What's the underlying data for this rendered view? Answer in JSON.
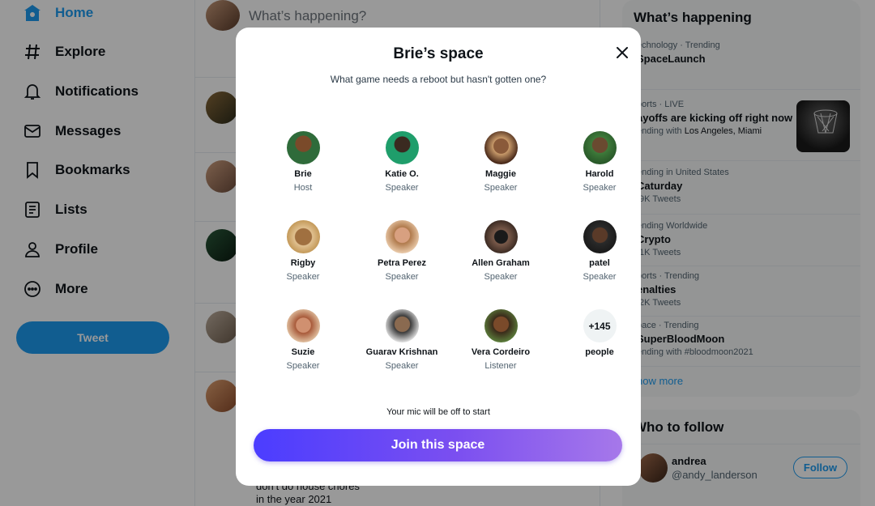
{
  "sidebar": {
    "items": [
      {
        "label": "Home",
        "icon": "home-icon"
      },
      {
        "label": "Explore",
        "icon": "hashtag-icon"
      },
      {
        "label": "Notifications",
        "icon": "bell-icon"
      },
      {
        "label": "Messages",
        "icon": "envelope-icon"
      },
      {
        "label": "Bookmarks",
        "icon": "bookmark-icon"
      },
      {
        "label": "Lists",
        "icon": "list-icon"
      },
      {
        "label": "Profile",
        "icon": "person-icon"
      },
      {
        "label": "More",
        "icon": "more-circle-icon"
      }
    ],
    "tweet_label": "Tweet"
  },
  "feed": {
    "compose_placeholder": "What’s happening?",
    "partial_tweet_line1": "don’t do house chores",
    "partial_tweet_line2": "in the year 2021"
  },
  "trends": {
    "title": "What’s happening",
    "items": [
      {
        "meta": "echnology · Trending",
        "name": "SpaceLaunch",
        "sub": ""
      },
      {
        "meta": "ports · LIVE",
        "name": "ayoffs are kicking off right now",
        "sub_prefix": "ending with ",
        "sub_bold": "Los Angeles, Miami"
      },
      {
        "meta": "ending in United States",
        "name": "Caturday",
        "sub": ".9K Tweets"
      },
      {
        "meta": "ending Worldwide",
        "name": "Crypto",
        "sub": ".1K Tweets"
      },
      {
        "meta": "ports · Trending",
        "name": "enalties",
        "sub": ".2K Tweets"
      },
      {
        "meta": "pace · Trending",
        "name": "SuperBloodMoon",
        "sub": "ending with #bloodmoon2021"
      }
    ],
    "show_more": "how more"
  },
  "who_to_follow": {
    "title": "Who to follow",
    "name": "andrea",
    "handle": "@andy_landerson",
    "follow_label": "Follow"
  },
  "modal": {
    "title": "Brie’s space",
    "subtitle": "What game needs a reboot but hasn't gotten one?",
    "participants": [
      {
        "name": "Brie",
        "role": "Host",
        "color": "#2f6b3a"
      },
      {
        "name": "Katie O.",
        "role": "Speaker",
        "color": "#1f9e6b"
      },
      {
        "name": "Maggie",
        "role": "Speaker",
        "color": "#b07a4a"
      },
      {
        "name": "Harold",
        "role": "Speaker",
        "color": "#3e7a3a"
      },
      {
        "name": "Rigby",
        "role": "Speaker",
        "color": "#c49a5a"
      },
      {
        "name": "Petra Perez",
        "role": "Speaker",
        "color": "#c78a5c"
      },
      {
        "name": "Allen Graham",
        "role": "Speaker",
        "color": "#5a3a2a"
      },
      {
        "name": "patel",
        "role": "Speaker",
        "color": "#2a2a2a"
      },
      {
        "name": "Suzie",
        "role": "Speaker",
        "color": "#a85a3a"
      },
      {
        "name": "Guarav Krishnan",
        "role": "Speaker",
        "color": "#6a5a4a"
      },
      {
        "name": "Vera Cordeiro",
        "role": "Listener",
        "color": "#8a5a2a"
      }
    ],
    "more_count": "+145",
    "more_label": "people",
    "mic_note": "Your mic will be off to start",
    "join_label": "Join this space"
  }
}
